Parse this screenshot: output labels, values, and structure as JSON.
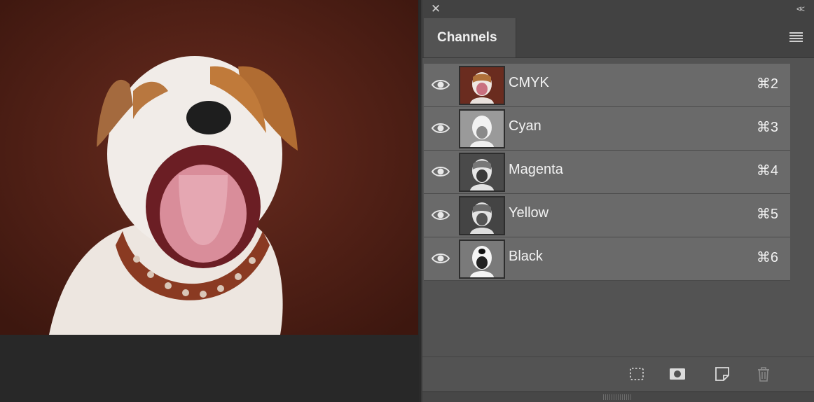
{
  "panel": {
    "title": "Channels",
    "close_icon": "close-icon",
    "collapse_icon": "collapse-icon",
    "menu_icon": "panel-menu-icon"
  },
  "channels": [
    {
      "label": "CMYK",
      "shortcut": "⌘2",
      "thumb_tone": "color"
    },
    {
      "label": "Cyan",
      "shortcut": "⌘3",
      "thumb_tone": "light"
    },
    {
      "label": "Magenta",
      "shortcut": "⌘4",
      "thumb_tone": "dark"
    },
    {
      "label": "Yellow",
      "shortcut": "⌘5",
      "thumb_tone": "dark"
    },
    {
      "label": "Black",
      "shortcut": "⌘6",
      "thumb_tone": "mid"
    }
  ],
  "bottom_icons": [
    "load-selection-icon",
    "save-selection-mask-icon",
    "new-channel-icon",
    "delete-channel-icon"
  ],
  "colors": {
    "panel_bg": "#535353",
    "row_bg": "#6a6a6a",
    "header_bg": "#424242",
    "photo_bg": "#5a2418"
  }
}
